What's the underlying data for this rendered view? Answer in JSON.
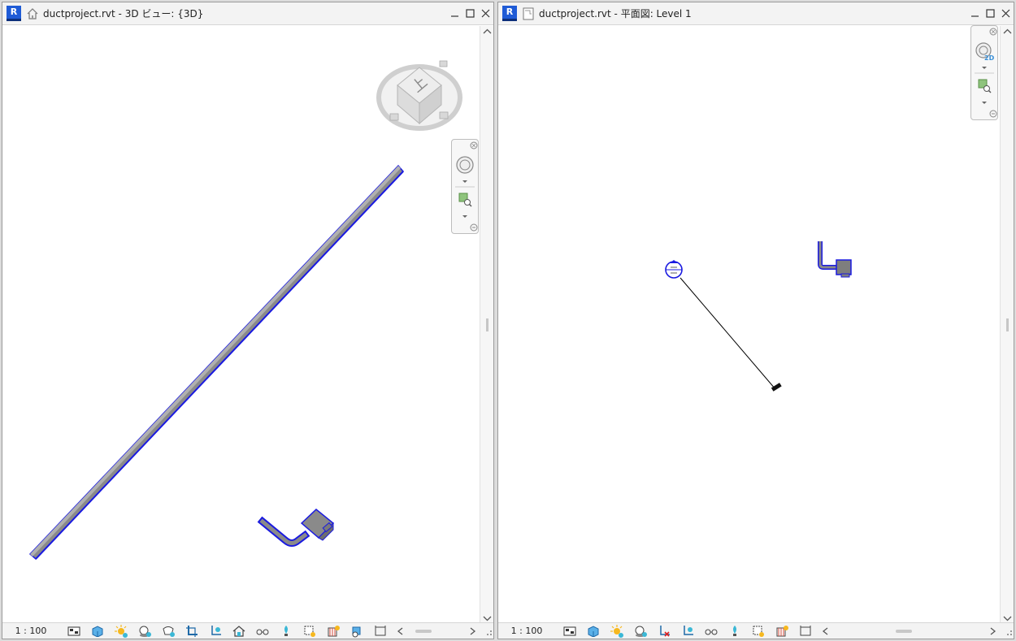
{
  "left_view": {
    "app_badge": "R",
    "title": "ductproject.rvt - 3D ビュー: {3D}",
    "view_type_icon": "house-3d-view-icon",
    "scale": "1 : 100",
    "viewcube_face": "上"
  },
  "right_view": {
    "app_badge": "R",
    "title": "ductproject.rvt - 平面図: Level 1",
    "view_type_icon": "floor-plan-view-icon",
    "scale": "1 : 100",
    "navwheel_label": "2D"
  },
  "colors": {
    "duct_fill": "#8a8a8a",
    "duct_edge": "#1a1ae0",
    "revit_blue": "#1f5bd6",
    "titlebar": "#f3f3f3"
  },
  "view_control_icons": [
    "detail-level-icon",
    "visual-style-icon",
    "sun-path-icon",
    "shadows-icon",
    "crop-region-icon",
    "show-crop-icon",
    "unlock-3d-icon",
    "temporary-hide-icon",
    "reveal-hidden-icon",
    "highlight-displacement-icon",
    "worksharing-icon",
    "design-options-icon",
    "analytical-model-icon",
    "constraints-icon"
  ]
}
